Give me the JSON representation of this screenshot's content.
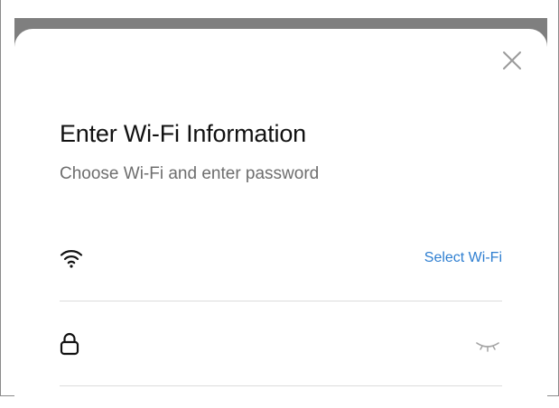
{
  "dialog": {
    "title": "Enter Wi-Fi Information",
    "subtitle": "Choose Wi-Fi and enter password",
    "close_icon": "close-icon"
  },
  "wifi_row": {
    "icon": "wifi-icon",
    "ssid_value": "",
    "select_label": "Select Wi-Fi"
  },
  "password_row": {
    "icon": "lock-icon",
    "password_value": "",
    "visibility_icon": "eye-closed-icon"
  },
  "colors": {
    "accent": "#2f7fd1",
    "backdrop": "#7f7f7f",
    "title": "#111111",
    "subtitle": "#6e6e6e",
    "divider": "#dcdcdc"
  }
}
